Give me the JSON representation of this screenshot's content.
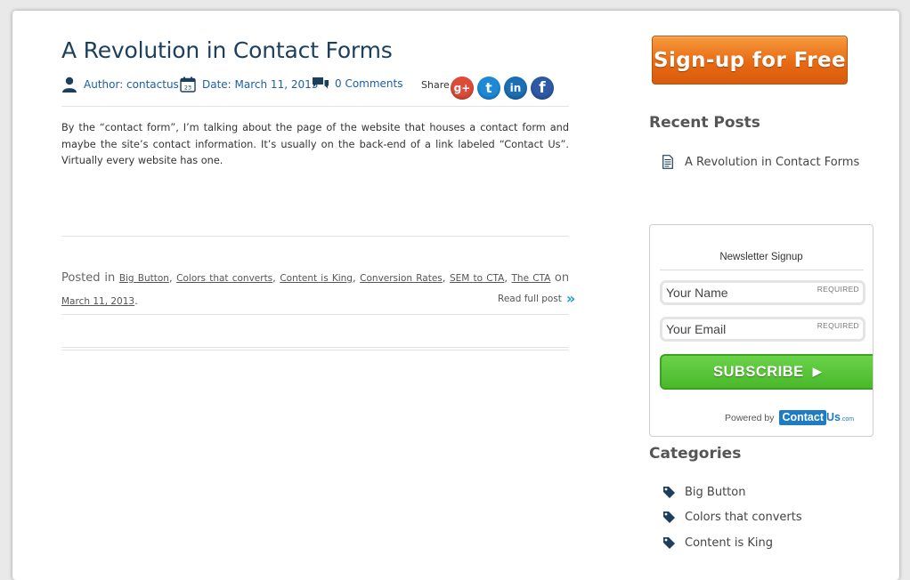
{
  "post": {
    "title": "A Revolution in Contact Forms",
    "author": "Author: contactus",
    "date": "Date: March 11, 2013",
    "calendar_day": "23",
    "comments": "0 Comments",
    "share_label": "Share",
    "social": [
      {
        "name": "gplus",
        "glyph": "g+"
      },
      {
        "name": "twitter",
        "glyph": "t"
      },
      {
        "name": "linkedin",
        "glyph": "in"
      },
      {
        "name": "facebook",
        "glyph": "f"
      }
    ],
    "excerpt": "By the “contact form”, I’m talking about the page of the website that houses a contact form and maybe the site’s contact information. It’s usually on the back-end of a link labeled “Contact Us”. Virtually every website has one.",
    "posted_in_label": "Posted in",
    "tags": [
      "Big Button",
      "Colors that converts",
      "Content is King",
      "Conversion Rates",
      "SEM to CTA",
      "The CTA"
    ],
    "on_label": "on",
    "date_link": "March 11, 2013",
    "read_more": "Read full post",
    "read_more_icon": "»"
  },
  "sidebar": {
    "signup_label": "Sign-up for Free",
    "recent_posts_heading": "Recent Posts",
    "recent_posts": [
      "A Revolution in Contact Forms"
    ],
    "newsletter": {
      "title": "Newsletter Signup",
      "name_placeholder": "Your Name",
      "email_placeholder": "Your Email",
      "required_label": "REQUIRED",
      "subscribe_label": "SUBSCRIBE",
      "subscribe_arrow": "▶",
      "powered_by": "Powered by",
      "logo_contact": "Contact",
      "logo_us": "Us",
      "logo_com": ".com"
    },
    "categories_heading": "Categories",
    "categories": [
      "Big Button",
      "Colors that converts",
      "Content is King"
    ]
  },
  "colors": {
    "title": "#1d3f5e",
    "link": "#1d5fa8",
    "signup_orange": "#e86a13",
    "subscribe_green": "#4ab82a"
  }
}
